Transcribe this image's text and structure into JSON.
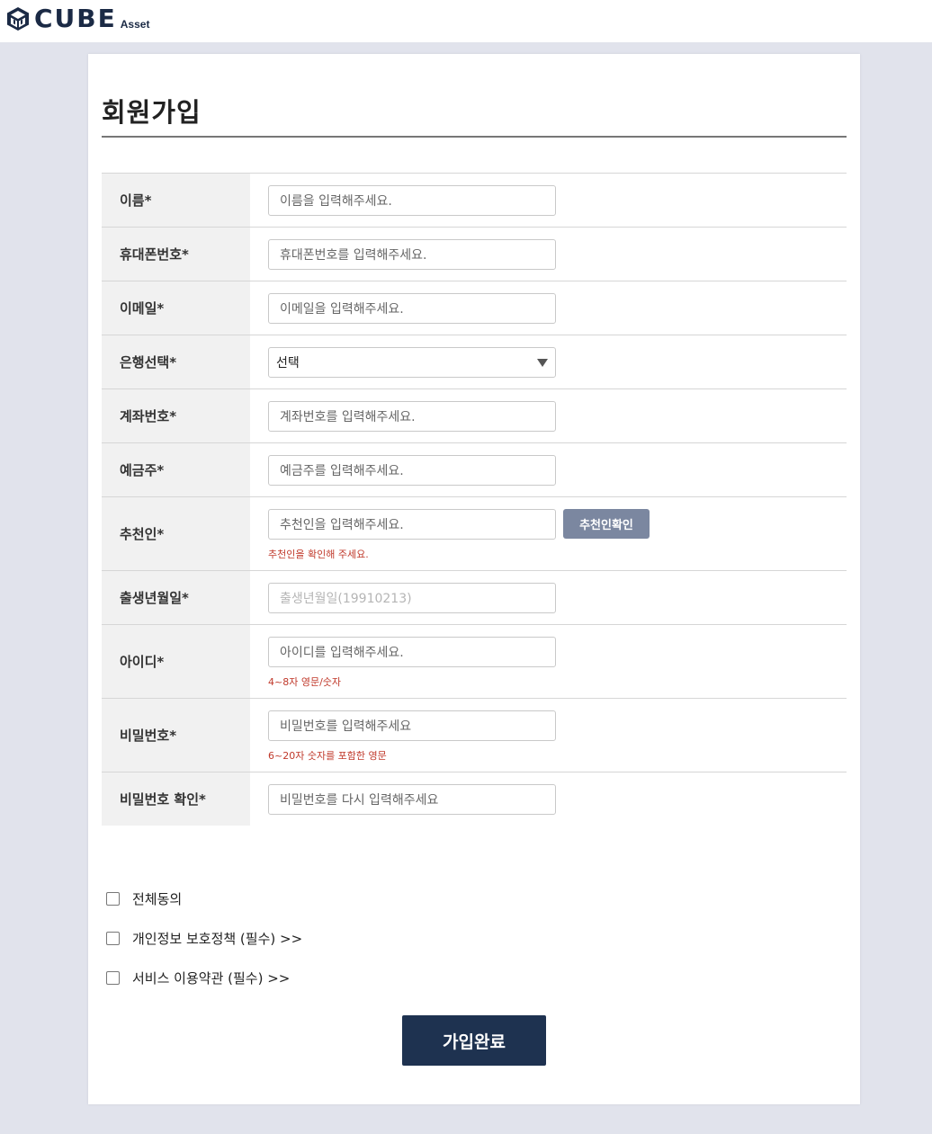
{
  "brand": {
    "name": "CUBE",
    "sub": "Asset"
  },
  "page": {
    "title": "회원가입"
  },
  "form": {
    "fields": [
      {
        "label": "이름*",
        "placeholder": "이름을 입력해주세요."
      },
      {
        "label": "휴대폰번호*",
        "placeholder": "휴대폰번호를 입력해주세요."
      },
      {
        "label": "이메일*",
        "placeholder": "이메일을 입력해주세요."
      },
      {
        "label": "은행선택*",
        "value": "선택"
      },
      {
        "label": "계좌번호*",
        "placeholder": "계좌번호를 입력해주세요."
      },
      {
        "label": "예금주*",
        "placeholder": "예금주를 입력해주세요."
      },
      {
        "label": "추천인*",
        "placeholder": "추천인을 입력해주세요.",
        "button": "추천인확인",
        "hint": "추천인을 확인해 주세요."
      },
      {
        "label": "출생년월일*",
        "placeholder": "출생년월일(19910213)"
      },
      {
        "label": "아이디*",
        "placeholder": "아이디를 입력해주세요.",
        "hint": "4~8자 영문/숫자"
      },
      {
        "label": "비밀번호*",
        "placeholder": "비밀번호를 입력해주세요",
        "hint": "6~20자 숫자를 포함한 영문"
      },
      {
        "label": "비밀번호 확인*",
        "placeholder": "비밀번호를 다시 입력해주세요"
      }
    ]
  },
  "agreements": [
    {
      "label": "전체동의",
      "checked": false
    },
    {
      "label": "개인정보 보호정책 (필수) >>",
      "checked": false
    },
    {
      "label": "서비스 이용약관 (필수) >>",
      "checked": false
    }
  ],
  "submit_label": "가입완료",
  "colors": {
    "brand": "#1b2a45",
    "submit_bg": "#1e3250",
    "check_button_bg": "#7b87a0",
    "hint": "#c0392b",
    "page_bg": "#e1e3ec"
  }
}
